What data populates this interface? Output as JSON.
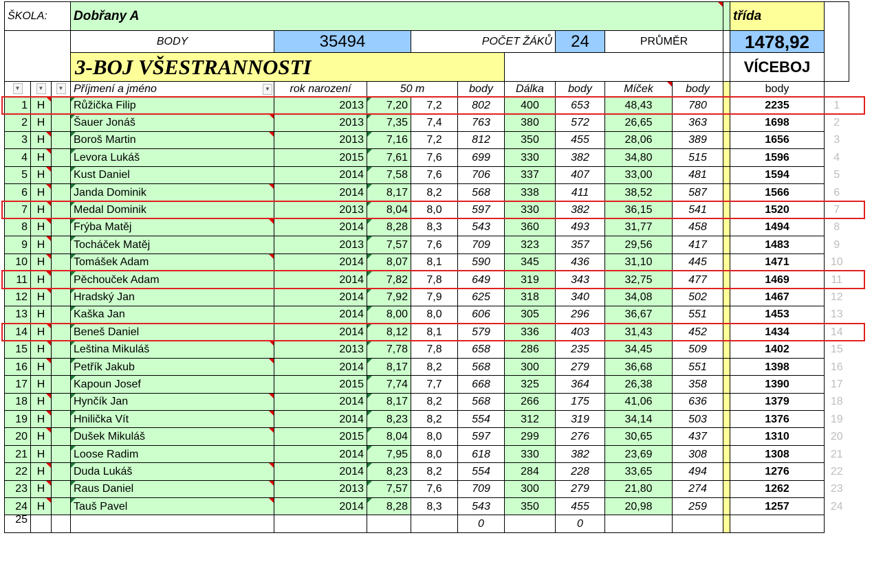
{
  "header": {
    "skola_label": "ŠKOLA:",
    "skola_name": "Dobřany A",
    "trida_label": "třída",
    "body_label": "BODY",
    "body_value": "35494",
    "pocet_label": "POČET ŽÁKŮ",
    "pocet_value": "24",
    "prumer_label": "PRŮMĚR",
    "prumer_value": "1478,92",
    "title": "3-BOJ VŠESTRANNOSTI",
    "viceboj": "VÍCEBOJ"
  },
  "columns": {
    "name": "Příjmení a jméno",
    "year": "rok narození",
    "run": "50 m",
    "run_points": "body",
    "jump": "Dálka",
    "jump_points": "body",
    "ball": "Míček",
    "ball_points": "body",
    "total": "body"
  },
  "rows": [
    {
      "n": "1",
      "s": "H",
      "name": "Růžička Filip",
      "year": "2013",
      "run": "7,20",
      "run_r": "7,2",
      "rp": "802",
      "jump": "400",
      "jp": "653",
      "ball": "48,43",
      "bp": "780",
      "total": "2235"
    },
    {
      "n": "2",
      "s": "H",
      "name": "Šauer Jonáš",
      "year": "2013",
      "run": "7,35",
      "run_r": "7,4",
      "rp": "763",
      "jump": "380",
      "jp": "572",
      "ball": "26,65",
      "bp": "363",
      "total": "1698"
    },
    {
      "n": "3",
      "s": "H",
      "name": "Boroš Martin",
      "year": "2013",
      "run": "7,16",
      "run_r": "7,2",
      "rp": "812",
      "jump": "350",
      "jp": "455",
      "ball": "28,06",
      "bp": "389",
      "total": "1656"
    },
    {
      "n": "4",
      "s": "H",
      "name": "Levora Lukáš",
      "year": "2015",
      "run": "7,61",
      "run_r": "7,6",
      "rp": "699",
      "jump": "330",
      "jp": "382",
      "ball": "34,80",
      "bp": "515",
      "total": "1596"
    },
    {
      "n": "5",
      "s": "H",
      "name": "Kust Daniel",
      "year": "2014",
      "run": "7,58",
      "run_r": "7,6",
      "rp": "706",
      "jump": "337",
      "jp": "407",
      "ball": "33,00",
      "bp": "481",
      "total": "1594"
    },
    {
      "n": "6",
      "s": "H",
      "name": "Janda Dominik",
      "year": "2014",
      "run": "8,17",
      "run_r": "8,2",
      "rp": "568",
      "jump": "338",
      "jp": "411",
      "ball": "38,52",
      "bp": "587",
      "total": "1566"
    },
    {
      "n": "7",
      "s": "H",
      "name": "Medal Dominik",
      "year": "2013",
      "run": "8,04",
      "run_r": "8,0",
      "rp": "597",
      "jump": "330",
      "jp": "382",
      "ball": "36,15",
      "bp": "541",
      "total": "1520"
    },
    {
      "n": "8",
      "s": "H",
      "name": "Frýba Matěj",
      "year": "2014",
      "run": "8,28",
      "run_r": "8,3",
      "rp": "543",
      "jump": "360",
      "jp": "493",
      "ball": "31,77",
      "bp": "458",
      "total": "1494"
    },
    {
      "n": "9",
      "s": "H",
      "name": "Tocháček Matěj",
      "year": "2013",
      "run": "7,57",
      "run_r": "7,6",
      "rp": "709",
      "jump": "323",
      "jp": "357",
      "ball": "29,56",
      "bp": "417",
      "total": "1483"
    },
    {
      "n": "10",
      "s": "H",
      "name": "Tomášek Adam",
      "year": "2014",
      "run": "8,07",
      "run_r": "8,1",
      "rp": "590",
      "jump": "345",
      "jp": "436",
      "ball": "31,10",
      "bp": "445",
      "total": "1471"
    },
    {
      "n": "11",
      "s": "H",
      "name": "Pěchouček Adam",
      "year": "2014",
      "run": "7,82",
      "run_r": "7,8",
      "rp": "649",
      "jump": "319",
      "jp": "343",
      "ball": "32,75",
      "bp": "477",
      "total": "1469"
    },
    {
      "n": "12",
      "s": "H",
      "name": "Hradský Jan",
      "year": "2014",
      "run": "7,92",
      "run_r": "7,9",
      "rp": "625",
      "jump": "318",
      "jp": "340",
      "ball": "34,08",
      "bp": "502",
      "total": "1467"
    },
    {
      "n": "13",
      "s": "H",
      "name": "Kaška Jan",
      "year": "2014",
      "run": "8,00",
      "run_r": "8,0",
      "rp": "606",
      "jump": "305",
      "jp": "296",
      "ball": "36,67",
      "bp": "551",
      "total": "1453"
    },
    {
      "n": "14",
      "s": "H",
      "name": "Beneš Daniel",
      "year": "2014",
      "run": "8,12",
      "run_r": "8,1",
      "rp": "579",
      "jump": "336",
      "jp": "403",
      "ball": "31,43",
      "bp": "452",
      "total": "1434"
    },
    {
      "n": "15",
      "s": "H",
      "name": "Leština Mikuláš",
      "year": "2013",
      "run": "7,78",
      "run_r": "7,8",
      "rp": "658",
      "jump": "286",
      "jp": "235",
      "ball": "34,45",
      "bp": "509",
      "total": "1402"
    },
    {
      "n": "16",
      "s": "H",
      "name": "Petřík Jakub",
      "year": "2014",
      "run": "8,17",
      "run_r": "8,2",
      "rp": "568",
      "jump": "300",
      "jp": "279",
      "ball": "36,68",
      "bp": "551",
      "total": "1398"
    },
    {
      "n": "17",
      "s": "H",
      "name": "Kapoun Josef",
      "year": "2015",
      "run": "7,74",
      "run_r": "7,7",
      "rp": "668",
      "jump": "325",
      "jp": "364",
      "ball": "26,38",
      "bp": "358",
      "total": "1390"
    },
    {
      "n": "18",
      "s": "H",
      "name": "Hynčík Jan",
      "year": "2014",
      "run": "8,17",
      "run_r": "8,2",
      "rp": "568",
      "jump": "266",
      "jp": "175",
      "ball": "41,06",
      "bp": "636",
      "total": "1379"
    },
    {
      "n": "19",
      "s": "H",
      "name": "Hnilička Vít",
      "year": "2014",
      "run": "8,23",
      "run_r": "8,2",
      "rp": "554",
      "jump": "312",
      "jp": "319",
      "ball": "34,14",
      "bp": "503",
      "total": "1376"
    },
    {
      "n": "20",
      "s": "H",
      "name": "Dušek Mikuláš",
      "year": "2015",
      "run": "8,04",
      "run_r": "8,0",
      "rp": "597",
      "jump": "299",
      "jp": "276",
      "ball": "30,65",
      "bp": "437",
      "total": "1310"
    },
    {
      "n": "21",
      "s": "H",
      "name": "Loose Radim",
      "year": "2014",
      "run": "7,95",
      "run_r": "8,0",
      "rp": "618",
      "jump": "330",
      "jp": "382",
      "ball": "23,69",
      "bp": "308",
      "total": "1308"
    },
    {
      "n": "22",
      "s": "H",
      "name": "Duda Lukáš",
      "year": "2014",
      "run": "8,23",
      "run_r": "8,2",
      "rp": "554",
      "jump": "284",
      "jp": "228",
      "ball": "33,65",
      "bp": "494",
      "total": "1276"
    },
    {
      "n": "23",
      "s": "H",
      "name": "Raus Daniel",
      "year": "2013",
      "run": "7,57",
      "run_r": "7,6",
      "rp": "709",
      "jump": "300",
      "jp": "279",
      "ball": "21,80",
      "bp": "274",
      "total": "1262"
    },
    {
      "n": "24",
      "s": "H",
      "name": "Tauš Pavel",
      "year": "2014",
      "run": "8,28",
      "run_r": "8,3",
      "rp": "543",
      "jump": "350",
      "jp": "455",
      "ball": "20,98",
      "bp": "259",
      "total": "1257"
    }
  ],
  "last_row": {
    "n": "25",
    "rp": "0",
    "jp": "0"
  },
  "highlighted_rows": [
    1,
    7,
    11,
    14
  ],
  "colors": {
    "cell_green": "#ccffcc",
    "cell_blue": "#99ccff",
    "cell_yellow": "#ffff99",
    "highlight_border": "#e0201f"
  }
}
